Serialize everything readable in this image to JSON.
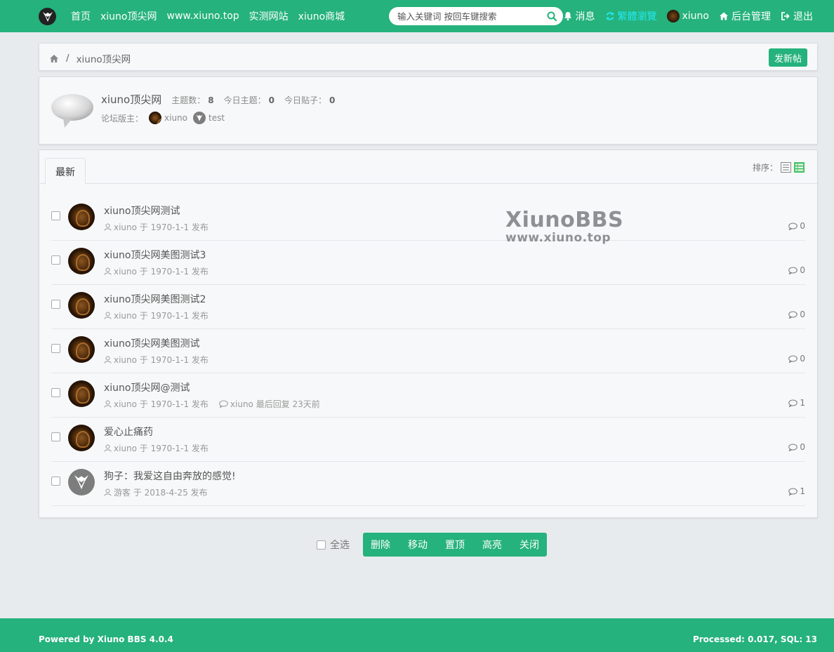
{
  "navbar": {
    "links": [
      "首页",
      "xiuno顶尖网",
      "www.xiuno.top",
      "实测网站",
      "xiuno商城"
    ],
    "search_placeholder": "输入关键词 按回车键搜索",
    "messages": "消息",
    "traditional": "繁體瀏覽",
    "username": "xiuno",
    "admin": "后台管理",
    "logout": "退出"
  },
  "breadcrumb": {
    "separator": "/",
    "current": "xiuno顶尖网"
  },
  "new_thread_label": "发新帖",
  "forum": {
    "name": "xiuno顶尖网",
    "stats": [
      {
        "label": "主题数：",
        "value": "8"
      },
      {
        "label": "今日主题：",
        "value": "0"
      },
      {
        "label": "今日贴子：",
        "value": "0"
      }
    ],
    "moderators_label": "论坛版主：",
    "moderators": [
      "xiuno",
      "test"
    ]
  },
  "list": {
    "tab": "最新",
    "sort_label": "排序：",
    "threads": [
      {
        "title": "xiuno顶尖网测试",
        "meta": "xiuno 于 1970-1-1 发布",
        "reply": "",
        "count": "0",
        "avatar": "dark"
      },
      {
        "title": "xiuno顶尖网美图测试3",
        "meta": "xiuno 于 1970-1-1 发布",
        "reply": "",
        "count": "0",
        "avatar": "dark"
      },
      {
        "title": "xiuno顶尖网美图测试2",
        "meta": "xiuno 于 1970-1-1 发布",
        "reply": "",
        "count": "0",
        "avatar": "dark"
      },
      {
        "title": "xiuno顶尖网美图测试",
        "meta": "xiuno 于 1970-1-1 发布",
        "reply": "",
        "count": "0",
        "avatar": "dark"
      },
      {
        "title": "xiuno顶尖网@测试",
        "meta": "xiuno 于 1970-1-1 发布",
        "reply": "xiuno 最后回复  23天前",
        "count": "1",
        "avatar": "dark"
      },
      {
        "title": "爱心止痛药",
        "meta": "xiuno 于 1970-1-1 发布",
        "reply": "",
        "count": "0",
        "avatar": "dark"
      },
      {
        "title": "狗子：我爱这自由奔放的感觉!",
        "meta": "游客 于 2018-4-25 发布",
        "reply": "",
        "count": "1",
        "avatar": "grey"
      }
    ]
  },
  "watermark": {
    "line1": "XiunoBBS",
    "line2": "www.xiuno.top"
  },
  "actions": {
    "select_all": "全选",
    "buttons": [
      "删除",
      "移动",
      "置顶",
      "高亮",
      "关闭"
    ]
  },
  "footer": {
    "left": "Powered by Xiuno BBS 4.0.4",
    "right": "Processed: 0.017, SQL: 13"
  },
  "colors": {
    "brand": "#25b27c",
    "accent_cyan": "#23e8f0"
  }
}
